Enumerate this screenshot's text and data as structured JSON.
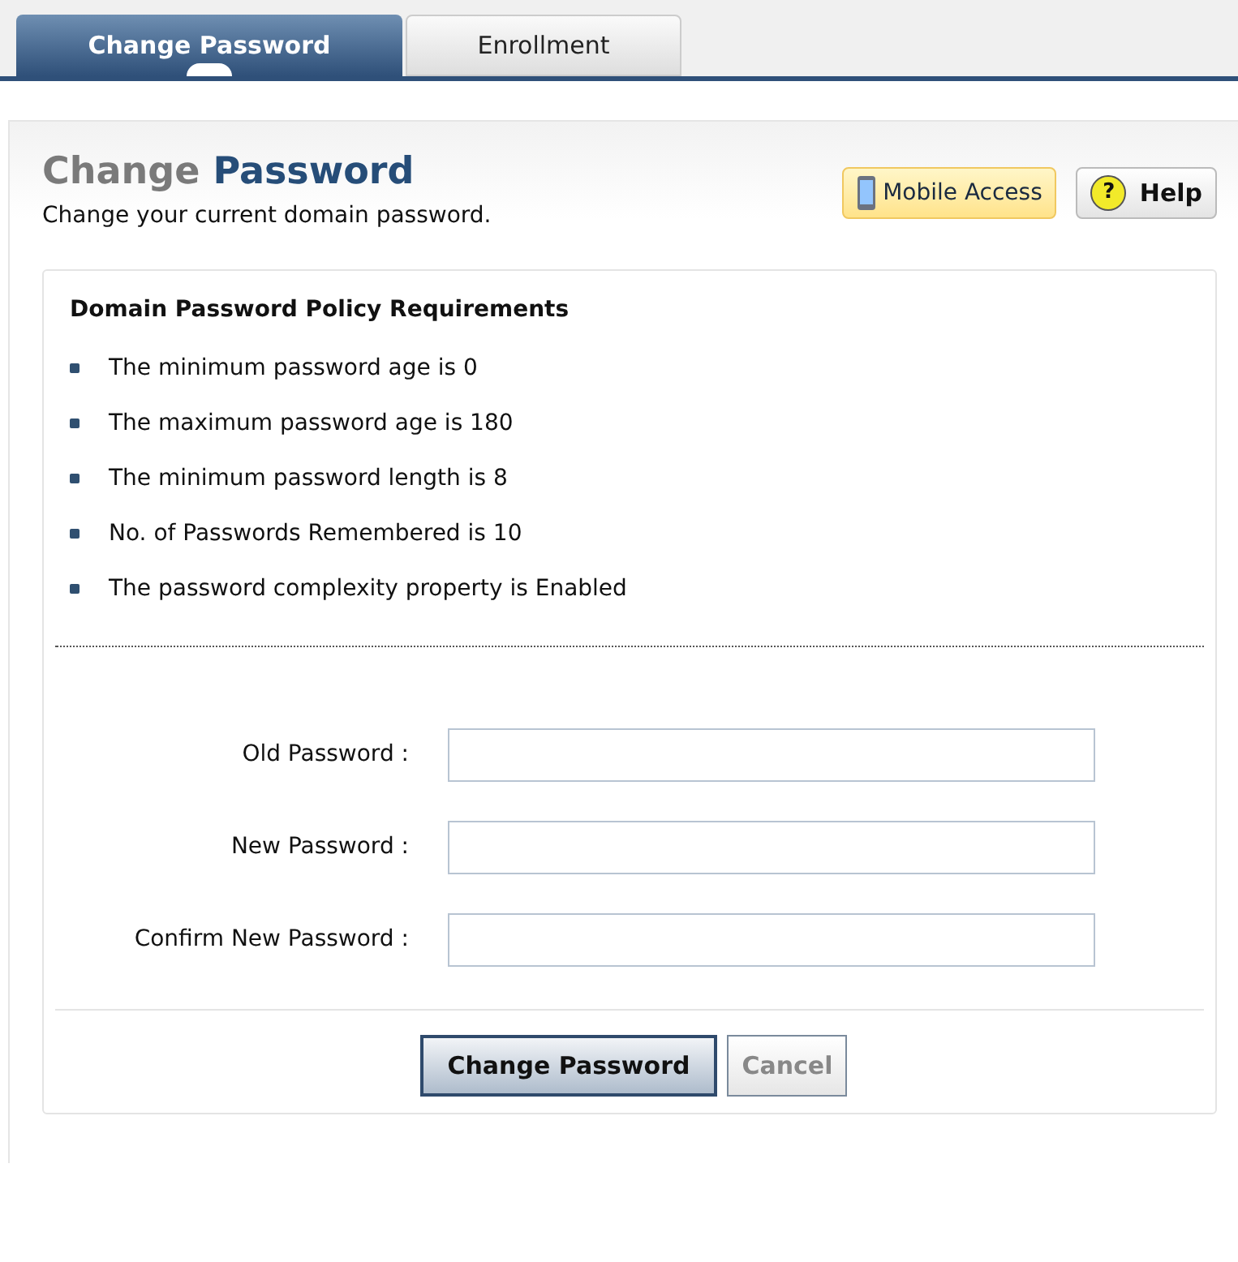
{
  "tabs": [
    {
      "label": "Change Password",
      "selected": true
    },
    {
      "label": "Enrollment",
      "selected": false
    }
  ],
  "header": {
    "title_lead": "Change",
    "title_main": "Password",
    "subtitle": "Change your current domain password."
  },
  "header_buttons": [
    {
      "kind": "mobile",
      "label": "Mobile Access"
    },
    {
      "kind": "help",
      "label": "Help",
      "icon_text": "?"
    }
  ],
  "policy": {
    "heading": "Domain Password Policy Requirements",
    "items": [
      "The minimum password age is 0",
      "The maximum password age is 180",
      "The minimum password length is 8",
      "No. of Passwords Remembered is 10",
      "The password complexity property is Enabled"
    ]
  },
  "fields": [
    {
      "label": "Old Password :"
    },
    {
      "label": "New Password :"
    },
    {
      "label": "Confirm New Password :"
    }
  ],
  "actions": [
    {
      "label": "Change Password",
      "disabled": false
    },
    {
      "label": "Cancel",
      "disabled": true
    }
  ]
}
